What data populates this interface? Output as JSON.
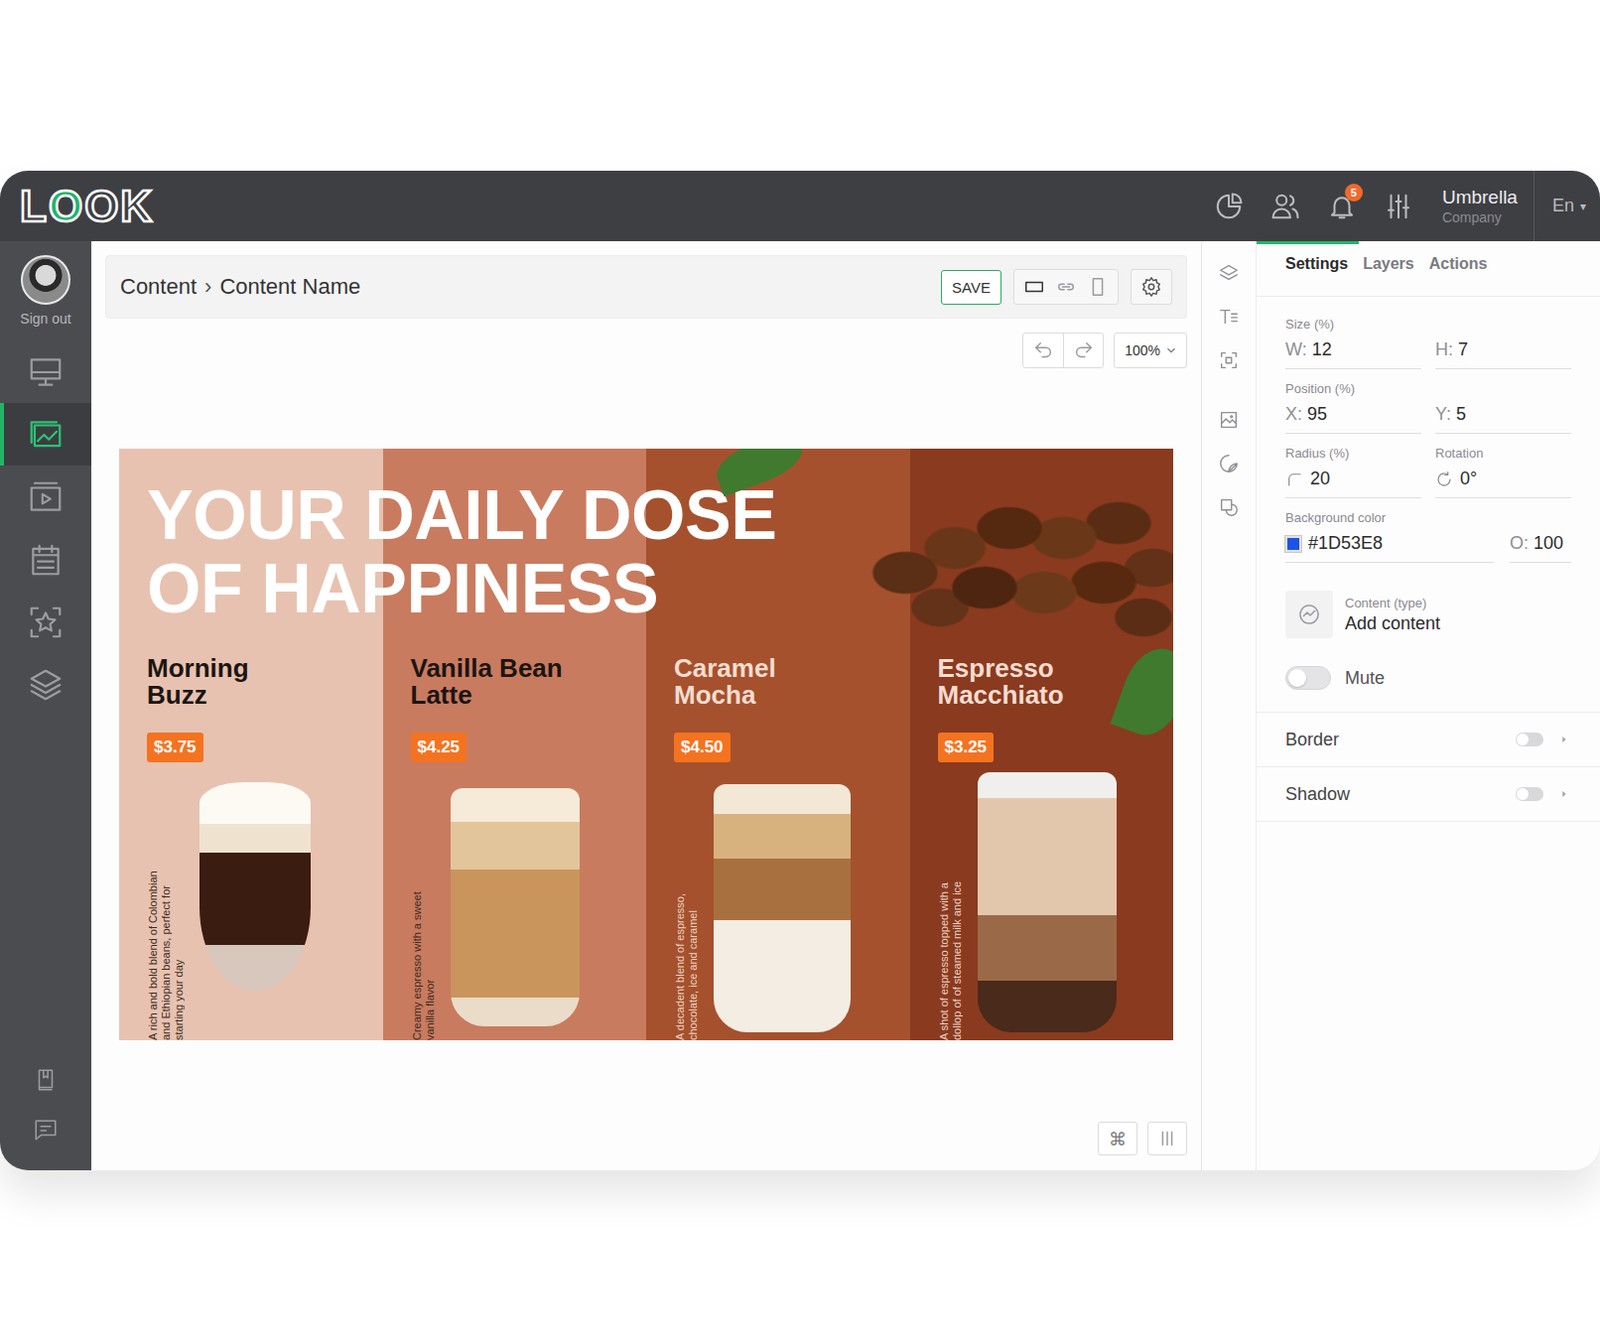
{
  "logo": "LOOK",
  "topbar": {
    "notification_count": "5",
    "company": "Umbrella",
    "company_sub": "Company",
    "language": "En",
    "language_caret": "▾"
  },
  "sidebar": {
    "user_label": "Sign out",
    "items": [
      {
        "selected": false
      },
      {
        "selected": true
      },
      {
        "selected": false
      },
      {
        "selected": false
      },
      {
        "selected": false
      },
      {
        "selected": false
      }
    ]
  },
  "breadcrumb": {
    "items": [
      "Content",
      "Content Name"
    ],
    "separator": "›"
  },
  "toolbar": {
    "save": "SAVE",
    "views": [
      {
        "selected": true
      },
      {
        "selected": false
      },
      {
        "selected": false
      }
    ],
    "zoom": "100%"
  },
  "design": {
    "headline": [
      "YOUR DAILY DOSE",
      "OF HAPPINESS"
    ],
    "items": [
      {
        "name": "Morning Buzz",
        "price": "$3.75",
        "description": "A rich and bold blend of Colombian and Ethiopian beans, perfect for starting your day",
        "color": "#E8C2B0"
      },
      {
        "name": "Vanilla Bean Latte",
        "price": "$4.25",
        "description": "Creamy espresso with a sweet vanilla flavor",
        "color": "#C97B5F"
      },
      {
        "name": "Caramel Mocha",
        "price": "$4.50",
        "description": "A decadent blend of espresso, chocolate, ice and caramel",
        "color": "#A5512D"
      },
      {
        "name": "Espresso Macchiato",
        "price": "$3.25",
        "description": "A shot of espresso topped with a dollop of of steamed milk and ice",
        "color": "#8A3A1F"
      }
    ]
  },
  "canvas_tools": {
    "shortcut": "⌘"
  },
  "panel": {
    "tabs": [
      {
        "label": "Settings",
        "selected": true
      },
      {
        "label": "Layers",
        "selected": false
      },
      {
        "label": "Actions",
        "selected": false
      }
    ],
    "rows": [
      {
        "kind": "pair",
        "label": "Size (%)",
        "fields": [
          {
            "prefix": "W:",
            "value": "12"
          },
          {
            "prefix": "H:",
            "value": "7"
          }
        ]
      },
      {
        "kind": "pair",
        "label": "Position (%)",
        "fields": [
          {
            "prefix": "X:",
            "value": "95"
          },
          {
            "prefix": "Y:",
            "value": "5"
          }
        ]
      },
      {
        "kind": "split",
        "fields": [
          {
            "label": "Radius (%)",
            "value": "20"
          },
          {
            "label": "Rotation",
            "value": "0°"
          }
        ]
      }
    ],
    "background": {
      "label": "Background color",
      "value": "#1D53E8",
      "opacity_prefix": "O:",
      "opacity": "100"
    },
    "content": {
      "label": "Content (type)",
      "value": "Add content"
    },
    "toggles": [
      {
        "kind": "inline",
        "label": "Mute",
        "on": false
      },
      {
        "kind": "section",
        "label": "Border",
        "on": false
      },
      {
        "kind": "section",
        "label": "Shadow",
        "on": false
      }
    ]
  }
}
